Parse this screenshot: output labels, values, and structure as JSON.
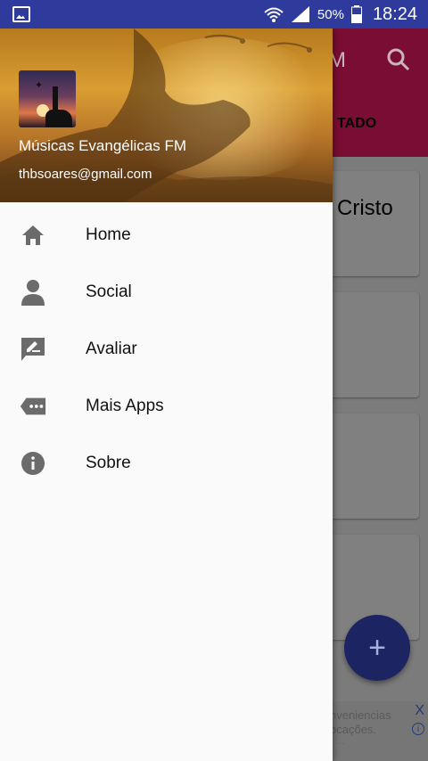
{
  "status_bar": {
    "battery_percent": "50%",
    "time": "18:24"
  },
  "background_app": {
    "toolbar_partial_title": "M",
    "tab_partial_label": "TADO",
    "card_partial_title": "Cristo",
    "fab_symbol": "+",
    "ad": {
      "line1": "nveniencias",
      "line2": "ocações.",
      "line3": "...",
      "close_symbol": "X",
      "info_symbol": "i"
    }
  },
  "drawer": {
    "header": {
      "title": "Músicas Evangélicas FM",
      "email": "thbsoares@gmail.com"
    },
    "items": [
      {
        "label": "Home",
        "icon": "home-icon"
      },
      {
        "label": "Social",
        "icon": "person-icon"
      },
      {
        "label": "Avaliar",
        "icon": "rate-review-icon"
      },
      {
        "label": "Mais Apps",
        "icon": "more-apps-icon"
      },
      {
        "label": "Sobre",
        "icon": "info-icon"
      }
    ]
  },
  "colors": {
    "status_bar": "#2f3b9c",
    "toolbar": "#7a0d33",
    "fab": "#1c2461",
    "drawer_bg": "#fafafa",
    "icon_gray": "#6b6b6b"
  }
}
